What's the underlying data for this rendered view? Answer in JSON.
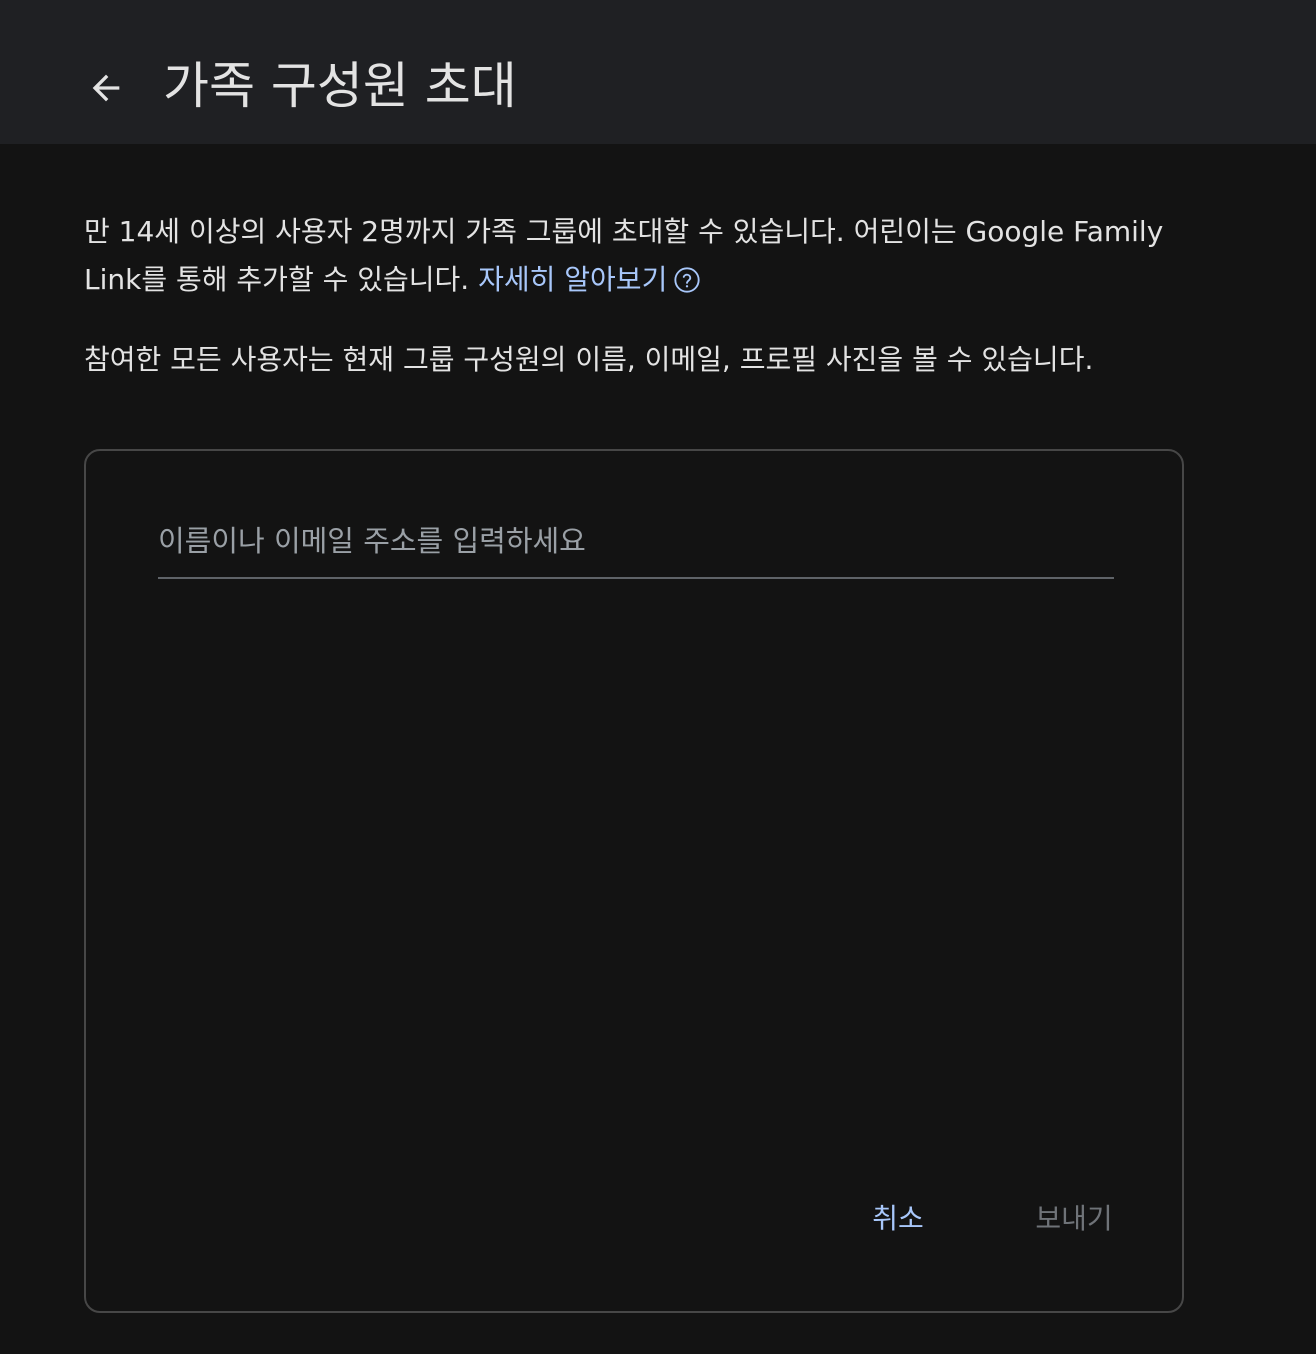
{
  "header": {
    "back_icon": "arrow-back-icon",
    "title": "가족 구성원 초대"
  },
  "description": {
    "text1": "만 14세 이상의 사용자 2명까지 가족 그룹에 초대할 수 있습니다. 어린이는 Google Family Link를 통해 추가할 수 있습니다. ",
    "learn_more": "자세히 알아보기",
    "help_icon": "help-circle-icon",
    "text2": "참여한 모든 사용자는 현재 그룹 구성원의 이름, 이메일, 프로필 사진을 볼 수 있습니다."
  },
  "invite_card": {
    "input_placeholder": "이름이나 이메일 주소를 입력하세요",
    "input_value": "",
    "cancel_label": "취소",
    "send_label": "보내기"
  },
  "colors": {
    "background": "#131313",
    "header_background": "#1f2023",
    "accent": "#a8c7fa",
    "disabled_text": "#6f7378"
  }
}
